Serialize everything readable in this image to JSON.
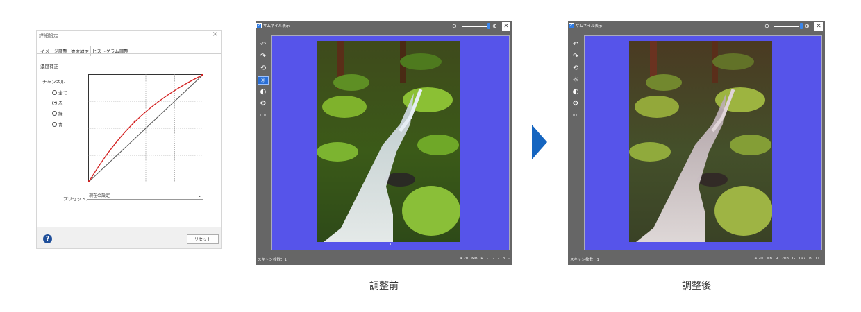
{
  "dialog": {
    "title": "詳細設定",
    "close": "×",
    "tabs": [
      "イメージ調整",
      "濃度補正",
      "ヒストグラム調整"
    ],
    "active_tab": "濃度補正",
    "section_title": "濃度補正",
    "channel_label": "チャンネル",
    "channels": [
      {
        "label": "全て",
        "selected": false
      },
      {
        "label": "赤",
        "selected": true
      },
      {
        "label": "緑",
        "selected": false
      },
      {
        "label": "青",
        "selected": false
      }
    ],
    "curve_color": "#d42020",
    "preset_label": "プリセット：",
    "preset_value": "現在の設定",
    "help": "?",
    "reset_label": "リセット"
  },
  "before": {
    "thumbnail_label": "サムネイル表示",
    "page_number": "1",
    "scan_count": "スキャン枚数：1",
    "status_meta": "4.20 MB  R  -  G  -  B  -",
    "caption": "調整前"
  },
  "after": {
    "thumbnail_label": "サムネイル表示",
    "page_number": "1",
    "scan_count": "スキャン枚数：1",
    "status_meta": "4.20 MB  R  203  G  197  B  111",
    "caption": "調整後"
  },
  "tools": [
    "rotate-left-icon",
    "rotate-right-icon",
    "rotate-180-icon",
    "auto-brightness-icon",
    "auto-contrast-icon",
    "settings-icon"
  ],
  "tool_value": "0.0",
  "colors": {
    "canvas": "#5654ea",
    "window": "#666666",
    "arrow": "#1565c0",
    "accent": "#2f7be3"
  }
}
